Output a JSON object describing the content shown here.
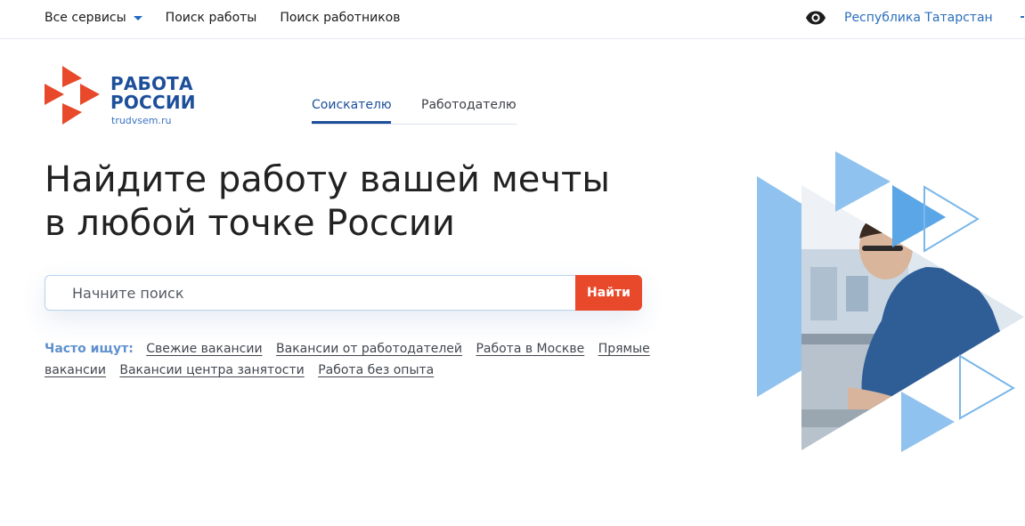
{
  "topnav": {
    "all_services": "Все сервисы",
    "job_search": "Поиск работы",
    "worker_search": "Поиск работников",
    "region": "Республика Татарстан",
    "accessibility_icon": "eye-icon"
  },
  "logo": {
    "line1": "РАБОТА",
    "line2": "РОССИИ",
    "url": "trudvsem.ru"
  },
  "tabs": [
    {
      "label": "Соискателю",
      "active": true
    },
    {
      "label": "Работодателю",
      "active": false
    }
  ],
  "hero": {
    "line1": "Найдите работу вашей мечты",
    "line2": "в любой точке России"
  },
  "search": {
    "placeholder": "Начните поиск",
    "button": "Найти"
  },
  "popular": {
    "label": "Часто ищут:",
    "links": [
      "Свежие вакансии",
      "Вакансии от работодателей",
      "Работа в Москве",
      "Прямые вакансии",
      "Вакансии центра занятости",
      "Работа без опыта"
    ]
  },
  "colors": {
    "brand_blue": "#1d4f9a",
    "accent_red": "#e8492b",
    "link_blue": "#2c6fbb",
    "light_blue": "#8fc2ee"
  }
}
